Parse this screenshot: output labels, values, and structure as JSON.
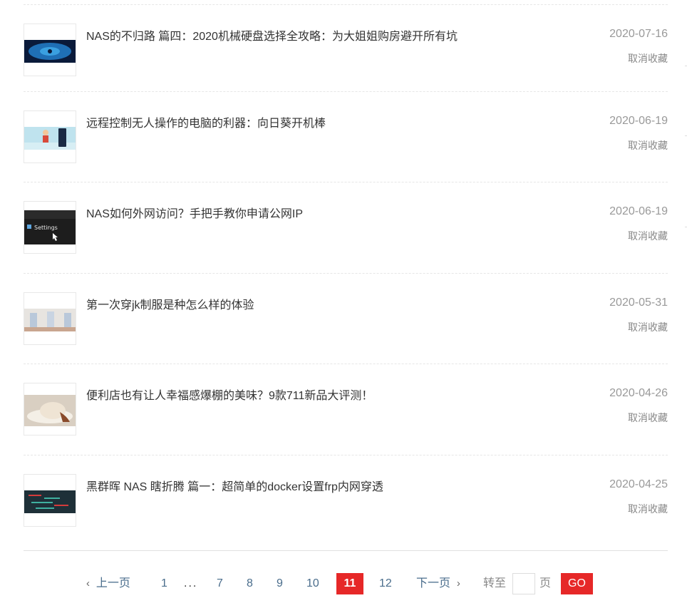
{
  "favorites": [
    {
      "title": "NAS的不归路 篇四：2020机械硬盘选择全攻略：为大姐姐购房避开所有坑",
      "date": "2020-07-16",
      "action": "取消收藏",
      "thumb_colors": [
        "#0a1a3a",
        "#1f6fb5",
        "#3aa0e0"
      ]
    },
    {
      "title": "远程控制无人操作的电脑的利器：向日葵开机棒",
      "date": "2020-06-19",
      "action": "取消收藏",
      "thumb_colors": [
        "#bfe3ee",
        "#d84a3a",
        "#1a2a44"
      ]
    },
    {
      "title": "NAS如何外网访问？手把手教你申请公网IP",
      "date": "2020-06-19",
      "action": "取消收藏",
      "thumb_colors": [
        "#1d1d1d",
        "#3c3c3c",
        "#5fa7e0"
      ]
    },
    {
      "title": "第一次穿jk制服是种怎么样的体验",
      "date": "2020-05-31",
      "action": "取消收藏",
      "thumb_colors": [
        "#e7e4e0",
        "#b9c8da",
        "#c9a690"
      ]
    },
    {
      "title": "便利店也有让人幸福感爆棚的美味？9款711新品大评测！",
      "date": "2020-04-26",
      "action": "取消收藏",
      "thumb_colors": [
        "#d9cfc2",
        "#f4efe6",
        "#8a4a2a"
      ]
    },
    {
      "title": "黑群晖 NAS 瞎折腾 篇一：超简单的docker设置frp内网穿透",
      "date": "2020-04-25",
      "action": "取消收藏",
      "thumb_colors": [
        "#1e3038",
        "#d33b3b",
        "#3fb0a0"
      ]
    }
  ],
  "pagination": {
    "prev_label": "上一页",
    "next_label": "下一页",
    "pages": [
      "1",
      "7",
      "8",
      "9",
      "10",
      "11",
      "12"
    ],
    "current": "11",
    "ellipsis": "...",
    "goto_label": "转至",
    "page_unit": "页",
    "go_label": "GO",
    "input_value": ""
  },
  "colors": {
    "accent": "#e62828",
    "link": "#4a6d8c"
  },
  "icons": {
    "prev": "chevron-left-icon",
    "next": "chevron-right-icon"
  }
}
